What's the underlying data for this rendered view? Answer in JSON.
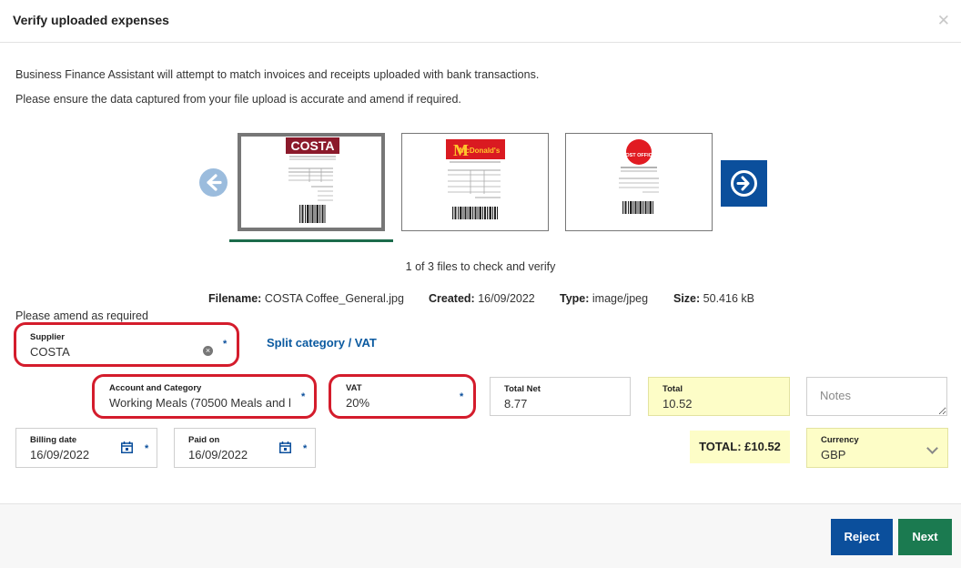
{
  "dialog": {
    "title": "Verify uploaded expenses",
    "close_icon": "close-icon"
  },
  "intro": {
    "line1": "Business Finance Assistant will attempt to match invoices and receipts uploaded with bank transactions.",
    "line2": "Please ensure the data captured from your file upload is accurate and amend if required."
  },
  "carousel": {
    "prev_icon": "arrow-left-circle-icon",
    "next_icon": "arrow-right-circle-icon",
    "thumbnails": [
      {
        "name": "costa-receipt",
        "logo_text": "COSTA",
        "selected": true
      },
      {
        "name": "mcdonalds-receipt",
        "logo_text": "McDonald's",
        "selected": false
      },
      {
        "name": "post-office-receipt",
        "logo_text": "POST OFFICE",
        "selected": false
      }
    ],
    "counter": "1 of 3 files to check and verify"
  },
  "file_meta": {
    "filename_label": "Filename:",
    "filename": "COSTA Coffee_General.jpg",
    "created_label": "Created:",
    "created": "16/09/2022",
    "type_label": "Type:",
    "type": "image/jpeg",
    "size_label": "Size:",
    "size": "50.416 kB"
  },
  "form": {
    "amend_note": "Please amend as required",
    "supplier": {
      "label": "Supplier",
      "value": "COSTA"
    },
    "split_link": "Split category / VAT",
    "account": {
      "label": "Account and Category",
      "value": "Working Meals (70500 Meals and l"
    },
    "vat": {
      "label": "VAT",
      "value": "20%"
    },
    "total_net": {
      "label": "Total Net",
      "value": "8.77"
    },
    "total": {
      "label": "Total",
      "value": "10.52"
    },
    "notes": {
      "placeholder": "Notes"
    },
    "billing_date": {
      "label": "Billing date",
      "value": "16/09/2022"
    },
    "paid_on": {
      "label": "Paid on",
      "value": "16/09/2022"
    },
    "total_badge": "TOTAL: £10.52",
    "currency": {
      "label": "Currency",
      "value": "GBP"
    },
    "required_mark": "*"
  },
  "footer": {
    "reject_label": "Reject",
    "next_label": "Next"
  },
  "colors": {
    "primary_blue": "#0b4f9c",
    "primary_green": "#1b7a50",
    "highlight_yellow": "#fdfdc7",
    "annotation_red": "#d41c2c"
  }
}
